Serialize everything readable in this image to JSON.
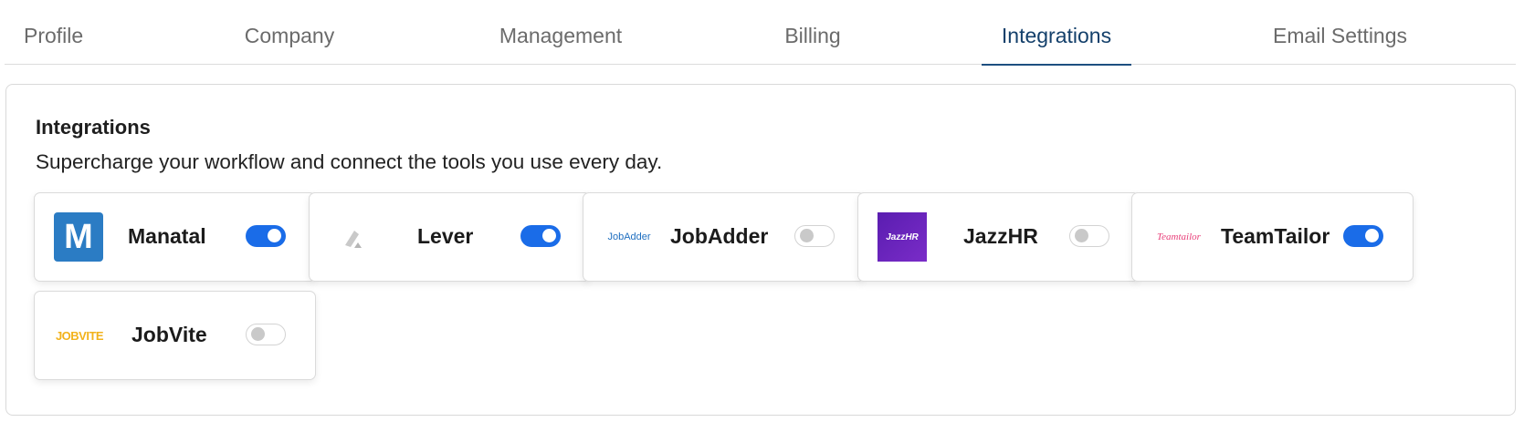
{
  "tabs": [
    {
      "label": "Profile",
      "active": false
    },
    {
      "label": "Company",
      "active": false
    },
    {
      "label": "Management",
      "active": false
    },
    {
      "label": "Billing",
      "active": false
    },
    {
      "label": "Integrations",
      "active": true
    },
    {
      "label": "Email Settings",
      "active": false
    }
  ],
  "panel": {
    "title": "Integrations",
    "subtitle": "Supercharge your workflow and connect the tools you use every day."
  },
  "integrations": [
    {
      "name": "Manatal",
      "enabled": true,
      "logo": "manatal-logo",
      "logo_text": "M",
      "brand_color": "#2b7cc4"
    },
    {
      "name": "Lever",
      "enabled": true,
      "logo": "lever-logo",
      "brand_color": "#c8c8c8"
    },
    {
      "name": "JobAdder",
      "enabled": false,
      "logo": "jobadder-logo",
      "logo_text": "JobAdder",
      "brand_color": "#1f6fc0"
    },
    {
      "name": "JazzHR",
      "enabled": false,
      "logo": "jazzhr-logo",
      "logo_text": "JazzHR",
      "brand_color": "#6a1fb6"
    },
    {
      "name": "TeamTailor",
      "enabled": true,
      "logo": "teamtailor-logo",
      "logo_text": "Teamtailor",
      "brand_color": "#e8407a"
    },
    {
      "name": "JobVite",
      "enabled": false,
      "logo": "jobvite-logo",
      "logo_text": "JOBVITE",
      "brand_color": "#f2b21b"
    }
  ],
  "colors": {
    "accent": "#1a6ce8",
    "active_tab": "#14406b"
  }
}
